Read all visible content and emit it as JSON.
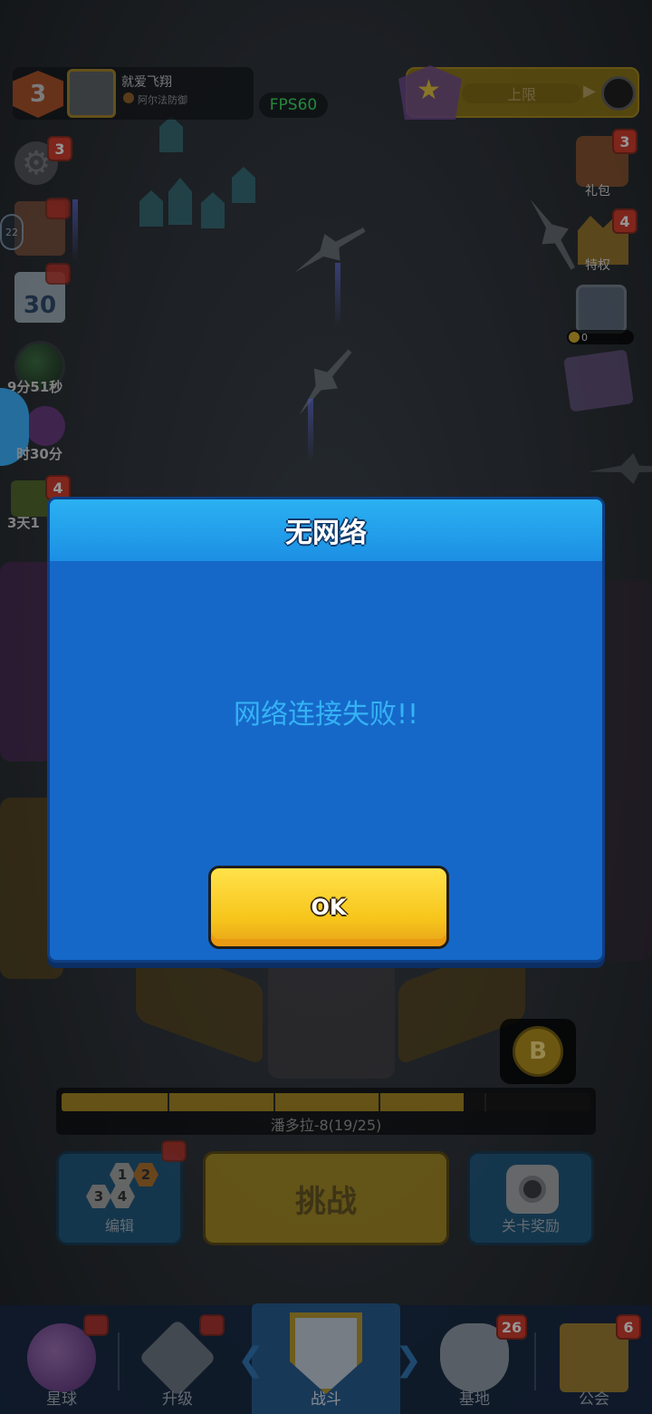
{
  "top_bar": {
    "level": "3",
    "player_name": "就爱飞翔",
    "guild_name": "阿尔法防御",
    "fps": "FPS60",
    "rank_label": "上限"
  },
  "left_icons": {
    "settings_badge": "3",
    "chat_count": "22",
    "calendar_day": "30",
    "timer_1": "9分51秒",
    "timer_2": "时30分",
    "timer_3": "3天1",
    "gift_badge": "4"
  },
  "right_icons": {
    "gift_pack_label": "礼包",
    "gift_pack_badge": "3",
    "privilege_label": "特权",
    "privilege_badge": "4",
    "safe_coins": "0"
  },
  "dialog": {
    "title": "无网络",
    "message": "网络连接失败!!",
    "ok_label": "OK"
  },
  "stage": {
    "coin_letter": "B",
    "progress_label": "潘多拉-8(19/25)",
    "progress_fraction": 0.76
  },
  "actions": {
    "edit_label": "编辑",
    "edit_hex_numbers": [
      "1",
      "2",
      "3",
      "4"
    ],
    "challenge_label": "挑战",
    "reward_label": "关卡奖励"
  },
  "nav": {
    "items": [
      {
        "label": "星球"
      },
      {
        "label": "升级"
      },
      {
        "label": "战斗"
      },
      {
        "label": "基地",
        "badge": "26"
      },
      {
        "label": "公会",
        "badge": "6"
      }
    ]
  },
  "colors": {
    "dialog_body": "#1668c8",
    "dialog_header": "#2bb1f2",
    "dialog_message": "#35b2f5",
    "ok_button": "#f7c51b",
    "fps_text": "#37d25c"
  }
}
